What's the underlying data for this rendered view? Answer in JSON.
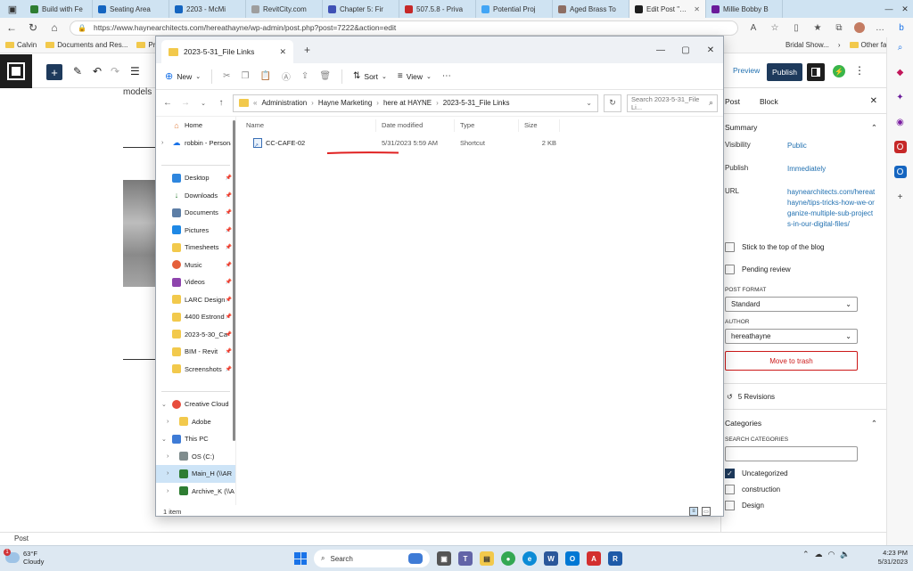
{
  "browser": {
    "tabs": [
      {
        "label": "Build with Fe",
        "color": "#2e7d32"
      },
      {
        "label": "Seating Area",
        "color": "#1565c0"
      },
      {
        "label": "2203 - McMi",
        "color": "#1565c0"
      },
      {
        "label": "RevitCity.com",
        "color": "#9e9e9e"
      },
      {
        "label": "Chapter 5: Fir",
        "color": "#3f51b5"
      },
      {
        "label": "507.5.8 - Priva",
        "color": "#c62828"
      },
      {
        "label": "Potential Proj",
        "color": "#42a5f5"
      },
      {
        "label": "Aged Brass To",
        "color": "#8d6e63"
      },
      {
        "label": "Edit Post \"Tips",
        "color": "#1e1e1e"
      },
      {
        "label": "Millie Bobby B",
        "color": "#6a1b9a"
      }
    ],
    "url": "https://www.haynearchitects.com/hereathayne/wp-admin/post.php?post=7222&action=edit",
    "favorites": [
      {
        "label": "Calvin"
      },
      {
        "label": "Documents and Res..."
      },
      {
        "label": "Pric"
      }
    ],
    "favorites_right": {
      "label1": "Bridal Show...",
      "label2": "Other favorites"
    }
  },
  "wordpress": {
    "preview_label": "Preview",
    "publish_label": "Publish",
    "canvas_fragment": "models",
    "status_label": "Post",
    "sidebar": {
      "tab_post": "Post",
      "tab_block": "Block",
      "summary_title": "Summary",
      "visibility_key": "Visibility",
      "visibility_val": "Public",
      "publish_key": "Publish",
      "publish_val": "Immediately",
      "url_key": "URL",
      "url_val": "haynearchitects.com/hereathayne/tips-tricks-how-we-organize-multiple-sub-projects-in-our-digital-files/",
      "sticky_label": "Stick to the top of the blog",
      "pending_label": "Pending review",
      "post_format_label": "POST FORMAT",
      "post_format_value": "Standard",
      "author_label": "AUTHOR",
      "author_value": "hereathayne",
      "trash_label": "Move to trash",
      "revisions_label": "5 Revisions",
      "categories_title": "Categories",
      "search_categories_label": "SEARCH CATEGORIES",
      "categories": [
        {
          "label": "Uncategorized",
          "checked": true
        },
        {
          "label": "construction",
          "checked": false
        },
        {
          "label": "Design",
          "checked": false
        }
      ]
    }
  },
  "explorer": {
    "tab_title": "2023-5-31_File Links",
    "cmd": {
      "new": "New",
      "sort": "Sort",
      "view": "View"
    },
    "breadcrumb": [
      "Administration",
      "Hayne Marketing",
      "here at HAYNE",
      "2023-5-31_File Links"
    ],
    "search_placeholder": "Search 2023-5-31_File Li...",
    "columns": {
      "name": "Name",
      "date": "Date modified",
      "type": "Type",
      "size": "Size"
    },
    "files": [
      {
        "name": "CC-CAFE-02",
        "date": "5/31/2023 5:59 AM",
        "type": "Shortcut",
        "size": "2 KB"
      }
    ],
    "tree": {
      "home": "Home",
      "onedrive": "robbin - Personal",
      "desktop": "Desktop",
      "downloads": "Downloads",
      "documents": "Documents",
      "pictures": "Pictures",
      "timesheets": "Timesheets",
      "music": "Music",
      "videos": "Videos",
      "larc": "LARC Design",
      "estrond": "4400 Estrond",
      "folder0530": "2023-5-30_Ca",
      "bim": "BIM - Revit",
      "screenshots": "Screenshots",
      "ccfiles": "Creative Cloud F",
      "adobe": "Adobe",
      "thispc": "This PC",
      "os": "OS (C:)",
      "main": "Main_H (\\\\AR",
      "archive": "Archive_K (\\\\A"
    },
    "status": "1 item"
  },
  "taskbar": {
    "temp": "63°F",
    "weather": "Cloudy",
    "weather_badge": "1",
    "search": "Search",
    "time": "4:23 PM",
    "date": "5/31/2023"
  }
}
